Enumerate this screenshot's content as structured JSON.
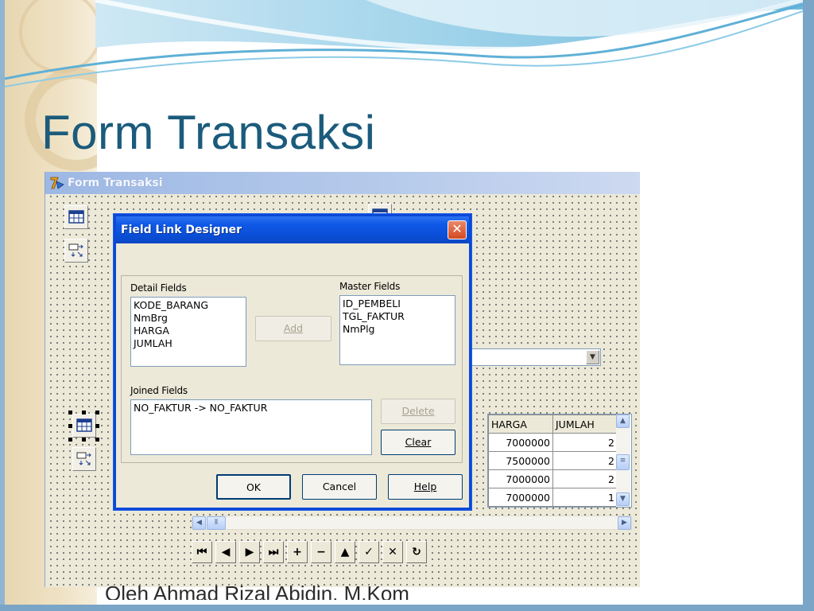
{
  "slide": {
    "title": "Form Transaksi",
    "footer": "Oleh Ahmad Rizal Abidin, M.Kom"
  },
  "form": {
    "title": "Form Transaksi"
  },
  "grid": {
    "columns": [
      "HARGA",
      "JUMLAH"
    ],
    "rows": [
      [
        "7000000",
        "2"
      ],
      [
        "7500000",
        "2"
      ],
      [
        "7000000",
        "2"
      ],
      [
        "7000000",
        "1"
      ]
    ]
  },
  "navigator": {
    "buttons": [
      "first",
      "prior",
      "next",
      "last",
      "insert",
      "delete",
      "edit",
      "post",
      "cancel",
      "refresh"
    ]
  },
  "dialog": {
    "title": "Field Link Designer",
    "detail_label": "Detail Fields",
    "detail_fields": [
      "KODE_BARANG",
      "NmBrg",
      "HARGA",
      "JUMLAH"
    ],
    "master_label": "Master Fields",
    "master_fields": [
      "ID_PEMBELI",
      "TGL_FAKTUR",
      "NmPlg"
    ],
    "add_label": "Add",
    "joined_label": "Joined Fields",
    "joined_fields": [
      "NO_FAKTUR -> NO_FAKTUR"
    ],
    "delete_label": "Delete",
    "clear_label": "Clear",
    "ok_label": "OK",
    "cancel_label": "Cancel",
    "help_label": "Help"
  },
  "colors": {
    "title_text": "#1b5b7c",
    "dialog_border": "#0a48d8",
    "close_button": "#d2491f"
  }
}
